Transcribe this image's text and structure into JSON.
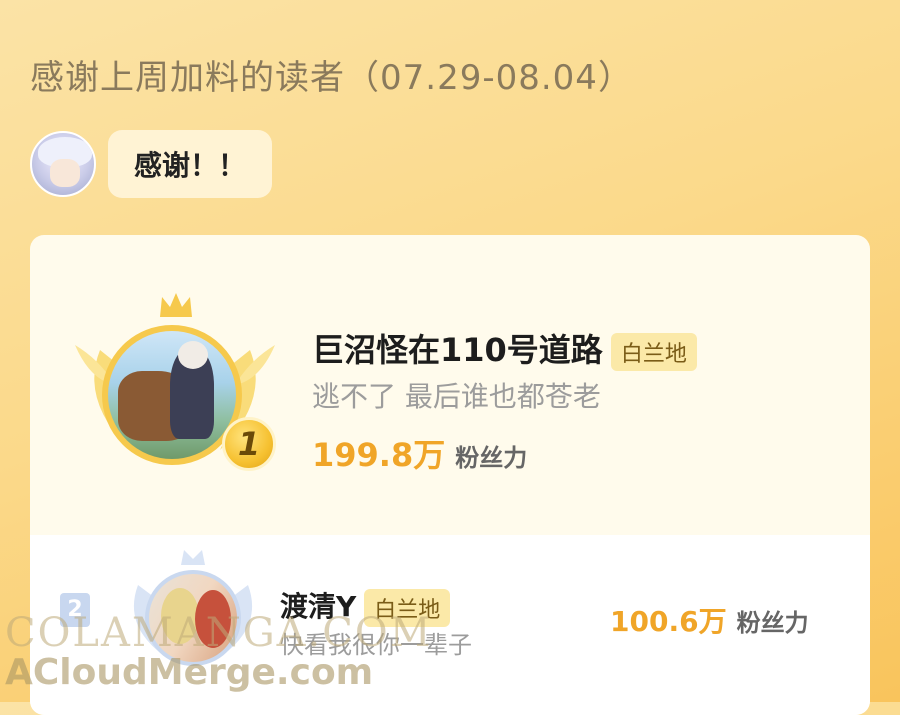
{
  "header": {
    "title": "感谢上周加料的读者（07.29-08.04）"
  },
  "message": {
    "text": "感谢！！"
  },
  "top_reader": {
    "rank": "1",
    "name": "巨沼怪在110号道路",
    "tag": "白兰地",
    "signature": "逃不了 最后谁也都苍老",
    "fans_value": "199.8万",
    "fans_label": "粉丝力"
  },
  "second_reader": {
    "rank": "2",
    "name": "渡清Y",
    "tag": "白兰地",
    "signature": "快看我很你一辈子",
    "fans_value": "100.6万",
    "fans_label": "粉丝力"
  },
  "watermarks": {
    "line1": "COLAMANGA.COM",
    "line2": "ACloudMerge.com"
  },
  "colors": {
    "accent": "#f0a528",
    "gold": "#f6c94c",
    "tag_bg": "#fbe9a8"
  },
  "icons": {
    "crown": "crown-icon",
    "laurel": "laurel-icon"
  }
}
